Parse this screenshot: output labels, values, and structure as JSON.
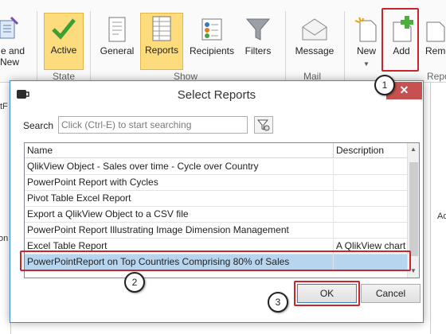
{
  "ribbon": {
    "cut_label_1": "e and",
    "cut_label_2": "New",
    "active_label": "Active",
    "state_group": "State",
    "general_label": "General",
    "reports_label": "Reports",
    "recipients_label": "Recipients",
    "filters_label": "Filters",
    "show_group": "Show",
    "message_label": "Message",
    "mail_group": "Mail",
    "new_label": "New",
    "add_label": "Add",
    "remove_label_cut": "Remo",
    "right_group_cut": "Repo",
    "colors": {
      "toggle_bg": "#fcdc7c",
      "add_green": "#4caf3c",
      "check_green": "#3aa035"
    }
  },
  "behind": {
    "left_cut": "tF",
    "left_cut_2": "on",
    "right_cut": "Adv"
  },
  "dialog": {
    "title": "Select Reports",
    "close_glyph": "✕",
    "search_label": "Search",
    "search_placeholder": "Click (Ctrl-E) to start searching",
    "columns": {
      "name": "Name",
      "description": "Description"
    },
    "rows": [
      {
        "name": "QlikView Object - Sales over time - Cycle over Country",
        "description": ""
      },
      {
        "name": "PowerPoint Report with Cycles",
        "description": ""
      },
      {
        "name": "Pivot Table Excel Report",
        "description": ""
      },
      {
        "name": "Export a QlikView Object to a CSV file",
        "description": ""
      },
      {
        "name": "PowerPoint Report Illustrating Image Dimension Management",
        "description": ""
      },
      {
        "name": "Excel Table Report",
        "description": "A QlikView chart"
      },
      {
        "name": "PowerPointReport on Top Countries Comprising 80% of Sales",
        "description": ""
      }
    ],
    "selected_row": "PowerPointReport on Top Countries Comprising 80% of Sales",
    "ok_label": "OK",
    "cancel_label": "Cancel"
  },
  "callouts": {
    "one": "1",
    "two": "2",
    "three": "3"
  },
  "annotation_color": "#c8262c"
}
